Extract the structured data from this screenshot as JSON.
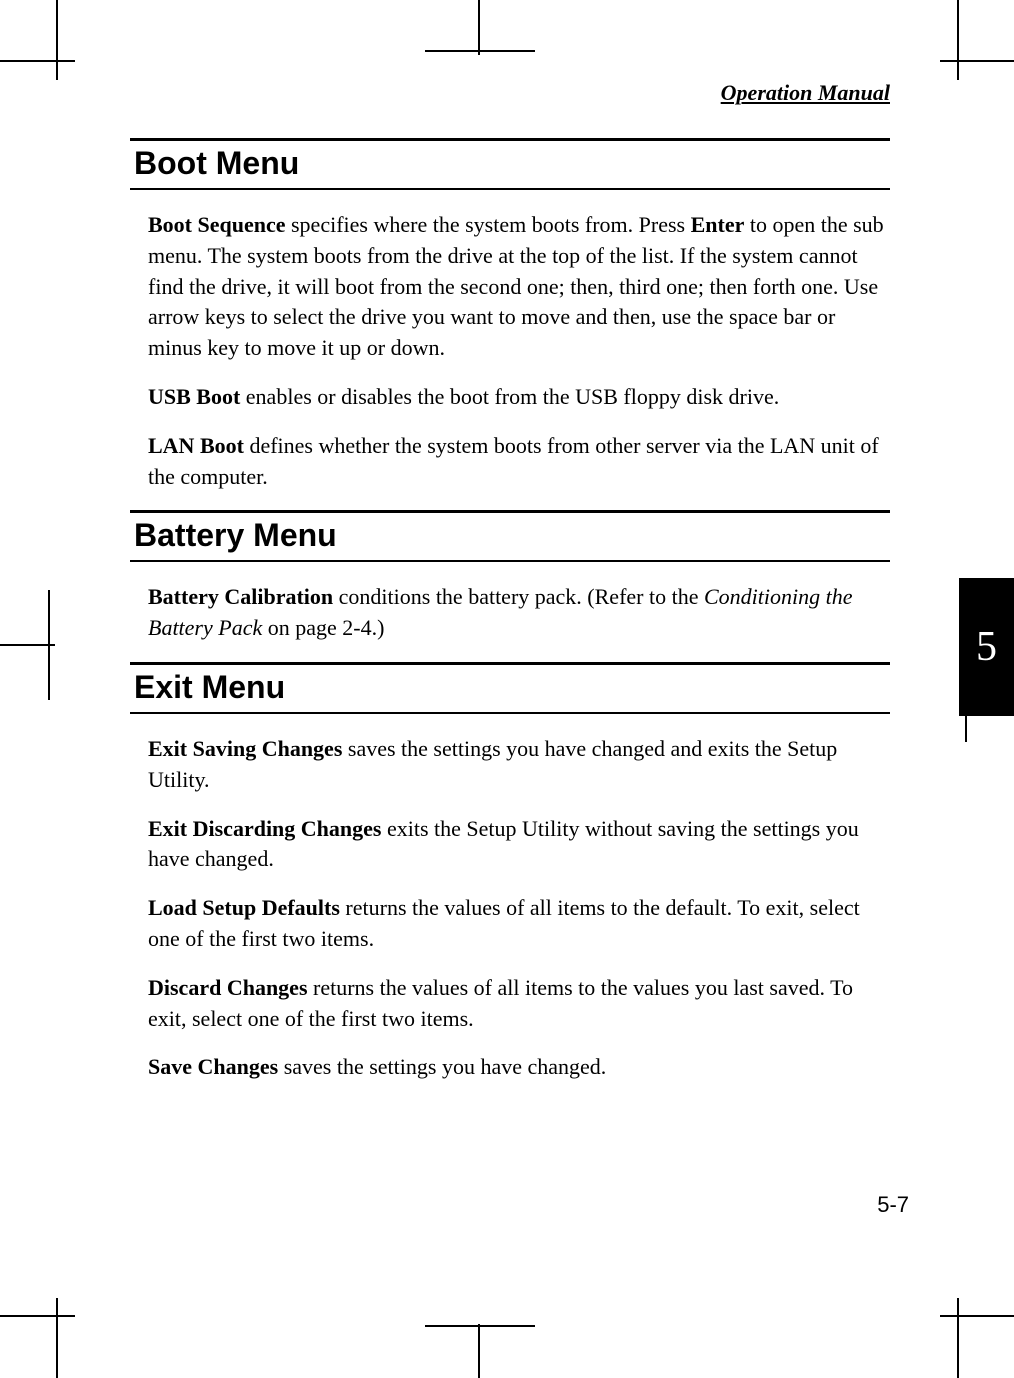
{
  "running_head": "Operation Manual",
  "chapter_tab": "5",
  "page_number": "5-7",
  "sections": {
    "boot": {
      "title": "Boot Menu",
      "p1_b1": "Boot Sequence",
      "p1_t1": " specifies where the system boots from. Press ",
      "p1_b2": "Enter",
      "p1_t2": " to open the sub menu. The system boots from the drive at the top of the list. If the system cannot find the drive, it will boot from the second one; then, third one; then forth one. Use arrow keys to select the drive you want to move and then, use the space bar or minus key to move it up or down.",
      "p2_b": "USB Boot",
      "p2_t": " enables or disables the boot from the USB floppy disk drive.",
      "p3_b": "LAN Boot",
      "p3_t": " defines whether the system boots from other server via the LAN unit of the computer."
    },
    "battery": {
      "title": "Battery Menu",
      "p1_b": "Battery Calibration",
      "p1_t1": " conditions the battery pack.  (Refer to the ",
      "p1_i": "Conditioning the Battery Pack",
      "p1_t2": " on page 2-4.)"
    },
    "exit": {
      "title": "Exit Menu",
      "p1_b": "Exit Saving Changes",
      "p1_t": " saves the settings you have changed and exits the Setup Utility.",
      "p2_b": "Exit Discarding Changes",
      "p2_t": " exits the Setup Utility without saving the settings you have changed.",
      "p3_b": "Load Setup Defaults",
      "p3_t": " returns the values of all items to the default.  To exit, select one of the first two items.",
      "p4_b": "Discard Changes",
      "p4_t": " returns the values of all items to the values you last saved. To exit, select one of the first two items.",
      "p5_b": "Save Changes",
      "p5_t": " saves the settings you have changed."
    }
  }
}
